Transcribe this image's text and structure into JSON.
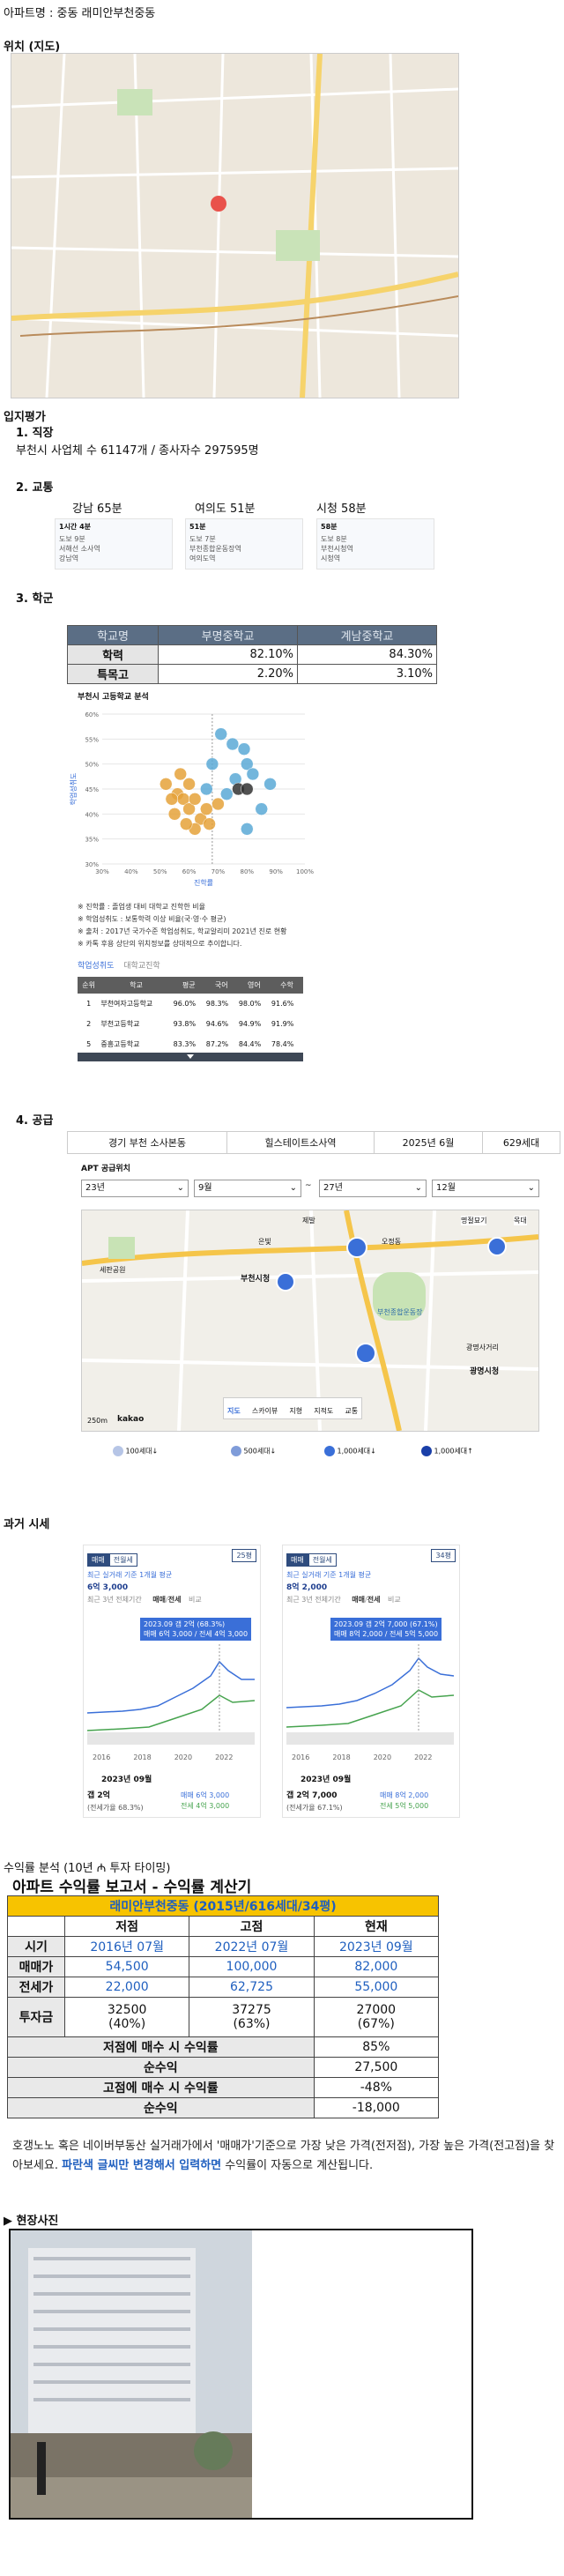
{
  "title": "아파트명 : 중동 래미안부천중동",
  "map_section": "위치 (지도)",
  "loc_section": "입지평가",
  "job": {
    "heading": "1. 직장",
    "text": "부천시 사업체 수 61147개 / 종사자수 297595명"
  },
  "traffic": {
    "heading": "2. 교통",
    "items": [
      {
        "label": "강남 65분",
        "badge": "1시간 4분",
        "rows": [
          "도보 9분",
          "서해선 소사역",
          "강남역"
        ]
      },
      {
        "label": "여의도 51분",
        "badge": "51분",
        "rows": [
          "도보 7분",
          "부천종합운동장역",
          "여의도역"
        ]
      },
      {
        "label": "시청 58분",
        "badge": "58분",
        "rows": [
          "도보 8분",
          "부천시청역",
          "시청역"
        ]
      }
    ]
  },
  "school": {
    "heading": "3. 학군",
    "cols": [
      "학교명",
      "부명중학교",
      "계남중학교"
    ],
    "rows": [
      {
        "label": "학력",
        "a": "82.10%",
        "b": "84.30%"
      },
      {
        "label": "특목고",
        "a": "2.20%",
        "b": "3.10%"
      }
    ],
    "chart_title": "부천시 고등학교 분석",
    "yaxis": "학업성취도",
    "xaxis": "진학률",
    "notes": [
      "※ 진학률 : 졸업생 대비 대학교 진학한 비율",
      "※ 학업성취도 : 보통학력 이상 비율(국·영·수 평균)",
      "※ 출처 : 2017년 국가수준 학업성취도, 학교알리미 2021년 진로 현황",
      "※ 카톡 후용 상단의 위치정보를 상대적으로 추이합니다."
    ],
    "tabs": [
      "학업성취도",
      "대학교진학"
    ],
    "ht_cols": [
      "순위",
      "학교",
      "평균",
      "국어",
      "영어",
      "수학"
    ],
    "ht_rows": [
      [
        "1",
        "부천여자고등학교",
        "96.0%",
        "98.3%",
        "98.0%",
        "91.6%"
      ],
      [
        "2",
        "부천고등학교",
        "93.8%",
        "94.6%",
        "94.9%",
        "91.9%"
      ],
      [
        "5",
        "중흥고등학교",
        "83.3%",
        "87.2%",
        "84.4%",
        "78.4%"
      ]
    ]
  },
  "chart_data": {
    "type": "scatter",
    "title": "부천시 고등학교 분석",
    "xlabel": "진학률",
    "ylabel": "학업성취도",
    "xlim": [
      30,
      100
    ],
    "ylim": [
      30,
      60
    ],
    "xticks": [
      "30%",
      "40%",
      "50%",
      "60%",
      "70%",
      "80%",
      "90%",
      "100%"
    ],
    "yticks": [
      "30%",
      "35%",
      "40%",
      "45%",
      "50%",
      "55%",
      "60%"
    ],
    "series": [
      {
        "name": "blue",
        "color": "#5aa9d6",
        "points": [
          [
            71,
            56
          ],
          [
            75,
            54
          ],
          [
            79,
            53
          ],
          [
            80,
            50
          ],
          [
            82,
            48
          ],
          [
            76,
            47
          ],
          [
            73,
            44
          ],
          [
            88,
            46
          ],
          [
            85,
            41
          ],
          [
            80,
            37
          ],
          [
            68,
            50
          ],
          [
            66,
            45
          ]
        ]
      },
      {
        "name": "orange",
        "color": "#e5a23a",
        "points": [
          [
            52,
            46
          ],
          [
            56,
            44
          ],
          [
            58,
            43
          ],
          [
            60,
            41
          ],
          [
            62,
            43
          ],
          [
            55,
            40
          ],
          [
            64,
            39
          ],
          [
            62,
            37
          ],
          [
            59,
            38
          ],
          [
            66,
            41
          ],
          [
            57,
            48
          ],
          [
            60,
            46
          ],
          [
            70,
            42
          ],
          [
            67,
            38
          ],
          [
            54,
            43
          ]
        ]
      },
      {
        "name": "dark",
        "color": "#333333",
        "points": [
          [
            77,
            45
          ],
          [
            80,
            45
          ]
        ]
      }
    ]
  },
  "supply": {
    "heading": "4. 공급",
    "row": [
      "경기 부천 소사본동",
      "힐스테이트소사역",
      "2025년 6월",
      "629세대"
    ],
    "map_title": "APT 공급위치",
    "selects": [
      "23년",
      "9월",
      "27년",
      "12월"
    ],
    "tilde": "~",
    "labels": [
      "명절묘기",
      "목대",
      "부천종합운동장",
      "부천시청",
      "광명사거리",
      "세판공원",
      "은빛",
      "제발",
      "광명시청",
      "오정동"
    ],
    "map_tabs": [
      "지도",
      "스카이뷰",
      "지형",
      "지적도",
      "교통"
    ],
    "kakao": "kakao",
    "scale": "250m",
    "legend": [
      "100세대↓",
      "500세대↓",
      "1,000세대↓",
      "1,000세대↑"
    ]
  },
  "past": {
    "heading": "과거 시세",
    "cards": [
      {
        "tab1": "매매",
        "tab2": "전월세",
        "size": "25평",
        "sub": "최근 실거래 기준 1개월 평균",
        "price": "6억 3,000",
        "period": [
          "최근 3년",
          "전체기간"
        ],
        "range_tabs": [
          "매매",
          "전세",
          "비교"
        ],
        "tooltip1": "2023.09  갭 2억 (68.3%)",
        "tooltip2": "매매 6억 3,000 / 전세 4억 3,000",
        "years": [
          "2016",
          "2018",
          "2020",
          "2022"
        ],
        "bottom_date": "2023년 09월",
        "gap": "갭 2억",
        "gap_ratio": "(전세가율 68.3%)",
        "sale": "매매 6억 3,000",
        "rent": "전세 4억 3,000"
      },
      {
        "tab1": "매매",
        "tab2": "전월세",
        "size": "34평",
        "sub": "최근 실거래 기준 1개월 평균",
        "price": "8억 2,000",
        "period": [
          "최근 3년",
          "전체기간"
        ],
        "range_tabs": [
          "매매",
          "전세",
          "비교"
        ],
        "tooltip1": "2023.09  갭 2억 7,000 (67.1%)",
        "tooltip2": "매매 8억 2,000 / 전세 5억 5,000",
        "years": [
          "2016",
          "2018",
          "2020",
          "2022"
        ],
        "bottom_date": "2023년 09월",
        "gap": "갭 2억 7,000",
        "gap_ratio": "(전세가율 67.1%)",
        "sale": "매매 8억 2,000",
        "rent": "전세 5억 5,000"
      }
    ]
  },
  "return": {
    "heading": "수익률 분석 (10년 ₼ 투자 타이밍)",
    "report_title": "아파트 수익률 보고서 - 수익률 계산기",
    "apt_name": "래미안부천중동 (2015년/616세대/34평)",
    "col": [
      "",
      "저점",
      "고점",
      "현재"
    ],
    "rows": [
      [
        "시기",
        "2016년 07월",
        "2022년 07월",
        "2023년 09월"
      ],
      [
        "매매가",
        "54,500",
        "100,000",
        "82,000"
      ],
      [
        "전세가",
        "22,000",
        "62,725",
        "55,000"
      ]
    ],
    "invest": {
      "label": "투자금",
      "a": "32500",
      "a2": "(40%)",
      "b": "37275",
      "b2": "(63%)",
      "c": "27000",
      "c2": "(67%)"
    },
    "summary": [
      [
        "저점에 매수 시 수익률",
        "85%"
      ],
      [
        "순수익",
        "27,500"
      ],
      [
        "고점에 매수 시 수익률",
        "-48%"
      ],
      [
        "순수익",
        "-18,000"
      ]
    ],
    "desc1": "호갱노노 혹은 네이버부동산 실거래가에서 '매매가'기준으로 가장 낮은 가격(전저점), 가장 높은 가격(전고점)을 찾아보세요. ",
    "desc_hl": "파란색 글씨만 변경해서 입력하면",
    "desc2": " 수익률이 자동으로 계산됩니다."
  },
  "photo": {
    "heading": "▶ 현장사진"
  }
}
